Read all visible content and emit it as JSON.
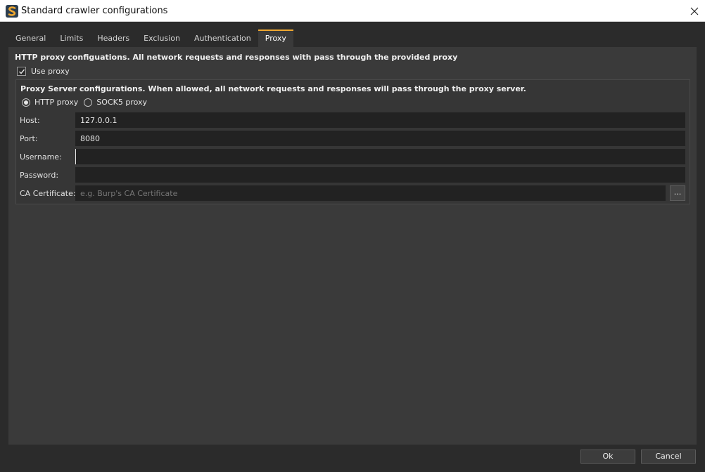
{
  "window": {
    "title": "Standard crawler configurations",
    "logo_icon": "s-logo-icon",
    "close_icon": "close-icon"
  },
  "tabs": [
    {
      "label": "General"
    },
    {
      "label": "Limits"
    },
    {
      "label": "Headers"
    },
    {
      "label": "Exclusion"
    },
    {
      "label": "Authentication"
    },
    {
      "label": "Proxy",
      "active": true
    }
  ],
  "proxy": {
    "heading": "HTTP proxy configuations. All network requests and responses with pass through the provided proxy",
    "use_proxy_label": "Use proxy",
    "use_proxy_checked": true,
    "server_heading": "Proxy Server configurations. When allowed, all network requests and responses will pass through the proxy server.",
    "radio_http": "HTTP proxy",
    "radio_socks": "SOCK5 proxy",
    "selected_type": "HTTP proxy",
    "host_label": "Host:",
    "host_value": "127.0.0.1",
    "port_label": "Port:",
    "port_value": "8080",
    "username_label": "Username:",
    "username_value": "",
    "password_label": "Password:",
    "password_value": "",
    "ca_label": "CA Certificate:",
    "ca_placeholder": "e.g. Burp's CA Certificate",
    "browse_label": "..."
  },
  "footer": {
    "ok_label": "Ok",
    "cancel_label": "Cancel"
  },
  "colors": {
    "accent": "#f0a830",
    "background": "#2b2b2b",
    "panel": "#3a3a3a"
  }
}
